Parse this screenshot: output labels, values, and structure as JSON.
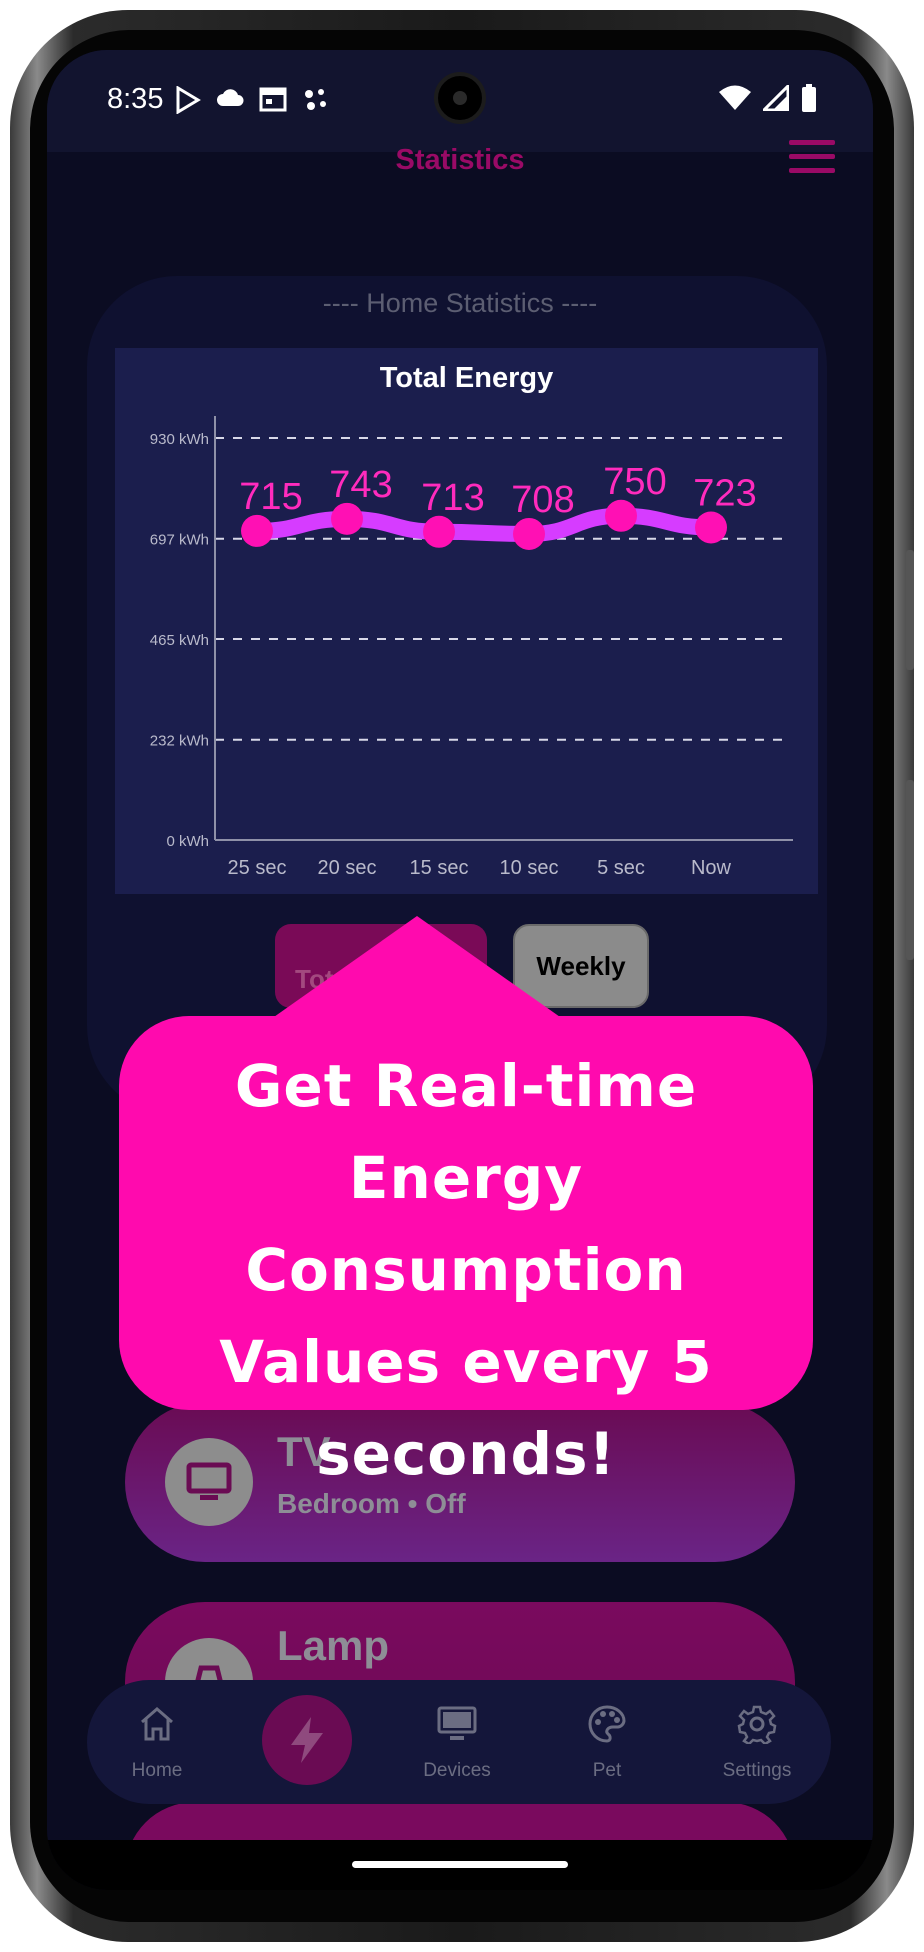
{
  "status_bar": {
    "time": "8:35"
  },
  "header": {
    "title": "Statistics"
  },
  "stats": {
    "subtitle": "---- Home Statistics ----",
    "total_average_label": "Total Ave",
    "weekly_label": "Weekly"
  },
  "chart_data": {
    "type": "line",
    "title": "Total Energy",
    "categories": [
      "25 sec",
      "20 sec",
      "15 sec",
      "10 sec",
      "5 sec",
      "Now"
    ],
    "values": [
      715,
      743,
      713,
      708,
      750,
      723
    ],
    "y_ticks": [
      "930 kWh",
      "697 kWh",
      "465 kWh",
      "232 kWh",
      "0 kWh"
    ],
    "y_tick_values": [
      930,
      697,
      465,
      232,
      0
    ],
    "ylim": [
      0,
      930
    ],
    "grid": true,
    "line_color": "#d63cff",
    "point_color": "#ff10b4",
    "label_color": "#ff2bbd"
  },
  "tooltip": {
    "lines": [
      "Get Real-time",
      "Energy Consumption",
      "Values every 5",
      "seconds!"
    ]
  },
  "devices": [
    {
      "name": "TV",
      "subtitle": "Bedroom • Off",
      "icon": "tv-icon"
    },
    {
      "name": "Lamp",
      "subtitle": "",
      "icon": "lamp-icon"
    }
  ],
  "nav": {
    "items": [
      {
        "label": "Home",
        "icon": "home-icon"
      },
      {
        "label": "",
        "icon": "lightning-icon"
      },
      {
        "label": "Devices",
        "icon": "monitor-icon"
      },
      {
        "label": "Pet",
        "icon": "palette-icon"
      },
      {
        "label": "Settings",
        "icon": "gear-icon"
      }
    ]
  },
  "colors": {
    "accent": "#ff0aae",
    "header_text": "#9a0a66",
    "background": "#0b0c22"
  }
}
